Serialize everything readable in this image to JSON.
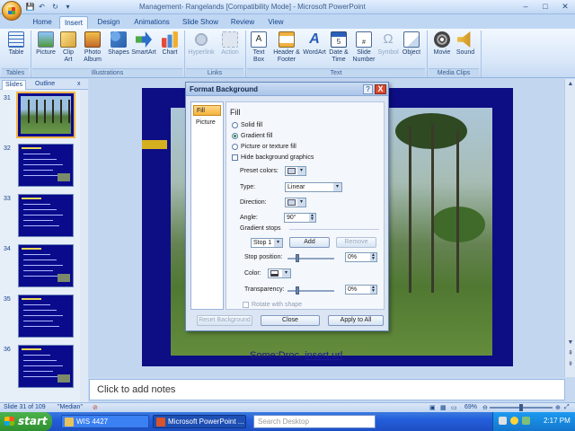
{
  "window": {
    "title": "Management- Rangelands [Compatibility Mode] - Microsoft PowerPoint",
    "minimize": "–",
    "maximize": "□",
    "close": "✕"
  },
  "qat": {
    "save": "💾",
    "undo": "↶",
    "redo": "↻",
    "more": "▾"
  },
  "tabs": [
    "Home",
    "Insert",
    "Design",
    "Animations",
    "Slide Show",
    "Review",
    "View"
  ],
  "active_tab": "Insert",
  "ribbon": {
    "groups": [
      {
        "label": "Tables",
        "buttons": [
          "Table"
        ]
      },
      {
        "label": "Illustrations",
        "buttons": [
          "Picture",
          "Clip Art",
          "Photo Album",
          "Shapes",
          "SmartArt",
          "Chart"
        ]
      },
      {
        "label": "Links",
        "buttons": [
          "Hyperlink",
          "Action"
        ]
      },
      {
        "label": "Text",
        "buttons": [
          "Text Box",
          "Header & Footer",
          "WordArt",
          "Date & Time",
          "Slide Number",
          "Symbol",
          "Object"
        ]
      },
      {
        "label": "Media Clips",
        "buttons": [
          "Movie",
          "Sound"
        ]
      }
    ]
  },
  "panel": {
    "tabs": [
      "Slides",
      "Outline"
    ],
    "close": "x",
    "thumbnails": [
      {
        "num": "31",
        "selected": true,
        "kind": "photo"
      },
      {
        "num": "32",
        "selected": false,
        "kind": "text"
      },
      {
        "num": "33",
        "selected": false,
        "kind": "text"
      },
      {
        "num": "34",
        "selected": false,
        "kind": "text"
      },
      {
        "num": "35",
        "selected": false,
        "kind": "text"
      },
      {
        "num": "36",
        "selected": false,
        "kind": "text"
      }
    ]
  },
  "slide": {
    "caption_prefix": "Some:Droc.",
    "caption_link": "insert.url"
  },
  "notes": {
    "placeholder": "Click to add notes"
  },
  "status": {
    "slide_info": "Slide 31 of 109",
    "theme": "\"Median\"",
    "zoom": "69%",
    "zoom_fraction": 0.5
  },
  "taskbar": {
    "start": "start",
    "items": [
      {
        "label": "WIS 4427",
        "color": "#e8c25a"
      },
      {
        "label": "Microsoft PowerPoint ...",
        "color": "#d9532b"
      }
    ],
    "search_placeholder": "Search Desktop",
    "clock": "2:17 PM"
  },
  "dialog": {
    "title": "Format Background",
    "help": "?",
    "close": "X",
    "nav": [
      "Fill",
      "Picture"
    ],
    "active_nav": "Fill",
    "heading": "Fill",
    "fill_options": [
      {
        "label": "Solid fill",
        "checked": false
      },
      {
        "label": "Gradient fill",
        "checked": true
      },
      {
        "label": "Picture or texture fill",
        "checked": false
      }
    ],
    "hide_graphics": "Hide background graphics",
    "preset_colors_label": "Preset colors:",
    "type_label": "Type:",
    "type_value": "Linear",
    "direction_label": "Direction:",
    "angle_label": "Angle:",
    "angle_value": "90°",
    "gradient_stops_label": "Gradient stops",
    "stop_value": "Stop 1",
    "add_button": "Add",
    "remove_button": "Remove",
    "stop_position_label": "Stop position:",
    "stop_position_value": "0%",
    "color_label": "Color:",
    "transparency_label": "Transparency:",
    "transparency_value": "0%",
    "rotate_label": "Rotate with shape",
    "reset_button": "Reset Background",
    "close_button": "Close",
    "apply_all_button": "Apply to All"
  }
}
